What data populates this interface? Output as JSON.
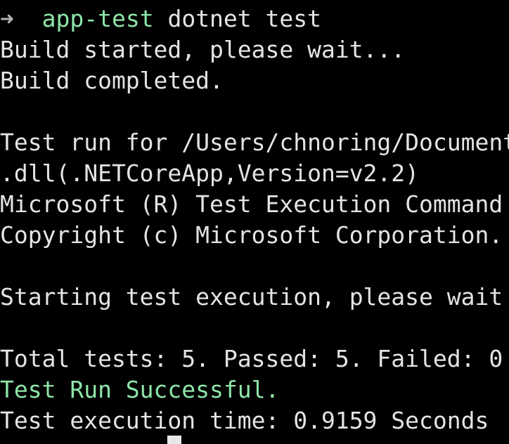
{
  "prompt": {
    "arrow": "➜",
    "directory": "app-test",
    "command": "dotnet test"
  },
  "output": {
    "build_started": "Build started, please wait...",
    "build_completed": "Build completed.",
    "test_run_for": "Test run for /Users/chnoring/Document",
    "dll_line": ".dll(.NETCoreApp,Version=v2.2)",
    "ms_test_exec": "Microsoft (R) Test Execution Command",
    "copyright": "Copyright (c) Microsoft Corporation.",
    "starting": "Starting test execution, please wait",
    "totals": "Total tests: 5. Passed: 5. Failed: 0",
    "success": "Test Run Successful.",
    "exec_time": "Test execution time: 0.9159 Seconds"
  },
  "colors": {
    "background": "#000000",
    "text": "#e4e4e4",
    "accent_green": "#8ee6a8"
  }
}
